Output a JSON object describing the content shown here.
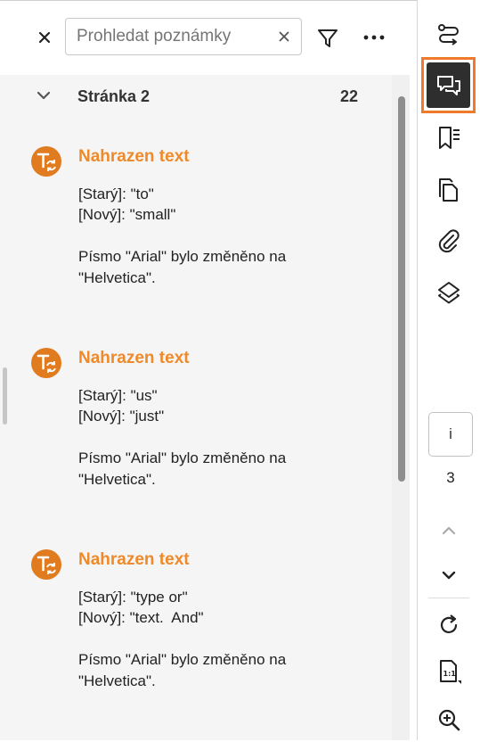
{
  "search": {
    "placeholder": "Prohledat poznámky",
    "value": ""
  },
  "section": {
    "title": "Stránka 2",
    "count": "22"
  },
  "notes": [
    {
      "title": "Nahrazen text",
      "old": "[Starý]: \"to\"",
      "new": "[Nový]: \"small\"",
      "desc": "Písmo \"Arial\" bylo změněno na \"Helvetica\"."
    },
    {
      "title": "Nahrazen text",
      "old": "[Starý]: \"us\"",
      "new": "[Nový]: \"just\"",
      "desc": "Písmo \"Arial\" bylo změněno na \"Helvetica\"."
    },
    {
      "title": "Nahrazen text",
      "old": "[Starý]: \"type or\"",
      "new": "[Nový]: \"text.  And\"",
      "desc": "Písmo \"Arial\" bylo změněno na \"Helvetica\"."
    }
  ],
  "pager": {
    "current": "i",
    "total": "3"
  },
  "colors": {
    "accent": "#ef8a2a",
    "avatar": "#e07b1f",
    "active_bg": "#2e2e2e"
  },
  "icons": {
    "rail": [
      "compare-icon",
      "comments-icon",
      "bookmarks-icon",
      "pages-icon",
      "attachment-icon",
      "layers-icon",
      "chevron-up-icon",
      "chevron-down-icon",
      "rotate-icon",
      "actual-size-icon",
      "zoom-in-icon"
    ]
  }
}
